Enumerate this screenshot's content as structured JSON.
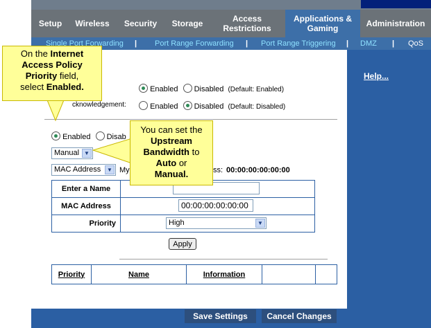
{
  "tabs": [
    {
      "label": "Setup",
      "active": false
    },
    {
      "label": "Wireless",
      "active": false
    },
    {
      "label": "Security",
      "active": false
    },
    {
      "label": "Storage",
      "active": false
    },
    {
      "label": "Access Restrictions",
      "active": false
    },
    {
      "label": "Applications & Gaming",
      "active": true
    },
    {
      "label": "Administration",
      "active": false
    }
  ],
  "subtabs": [
    {
      "label": "Single Port Forwarding"
    },
    {
      "label": "Port Range Forwarding"
    },
    {
      "label": "Port Range Triggering"
    },
    {
      "label": "DMZ"
    },
    {
      "label": "QoS",
      "active": true
    }
  ],
  "separator": "|",
  "help_link": "Help...",
  "wmm_row": {
    "enabled": "Enabled",
    "disabled": "Disabled",
    "default": "(Default: Enabled)"
  },
  "ack_row": {
    "label": "cknowledgement:",
    "enabled": "Enabled",
    "disabled": "Disabled",
    "default": "(Default: Disabled)"
  },
  "policy_row": {
    "enabled": "Enabled",
    "disabled": "Disab"
  },
  "upstream_select": {
    "value": "Manual"
  },
  "category_select": {
    "value": "MAC Address"
  },
  "my_label": "My",
  "my_mac_label": "ss:",
  "my_mac_value": "00:00:00:00:00:00",
  "form": {
    "name_label": "Enter a Name",
    "name_value": "",
    "mac_label": "MAC Address",
    "mac_value": "00:00:00:00:00:00",
    "priority_label": "Priority",
    "priority_value": "High"
  },
  "apply_button": "Apply",
  "summary_headers": [
    "Priority",
    "Name",
    "Information"
  ],
  "save_button": "Save Settings",
  "cancel_button": "Cancel Changes",
  "callout1": {
    "l1": "On the ",
    "l1b": "Internet",
    "l2": "Access Policy",
    "l3": "Priority",
    "l3b": " field,",
    "l4": "select ",
    "l4b": "Enabled."
  },
  "callout2": {
    "l1": "You can set the",
    "l2": "Upstream",
    "l3": "Bandwidth",
    "l3b": " to",
    "l4": "Auto",
    "l4b": " or",
    "l5": "Manual."
  },
  "colors": {
    "tab_bg": "#6b7278",
    "tab_active": "#3d6fa8",
    "panel_blue": "#2b5fa3",
    "callout_bg": "#ffff99"
  }
}
